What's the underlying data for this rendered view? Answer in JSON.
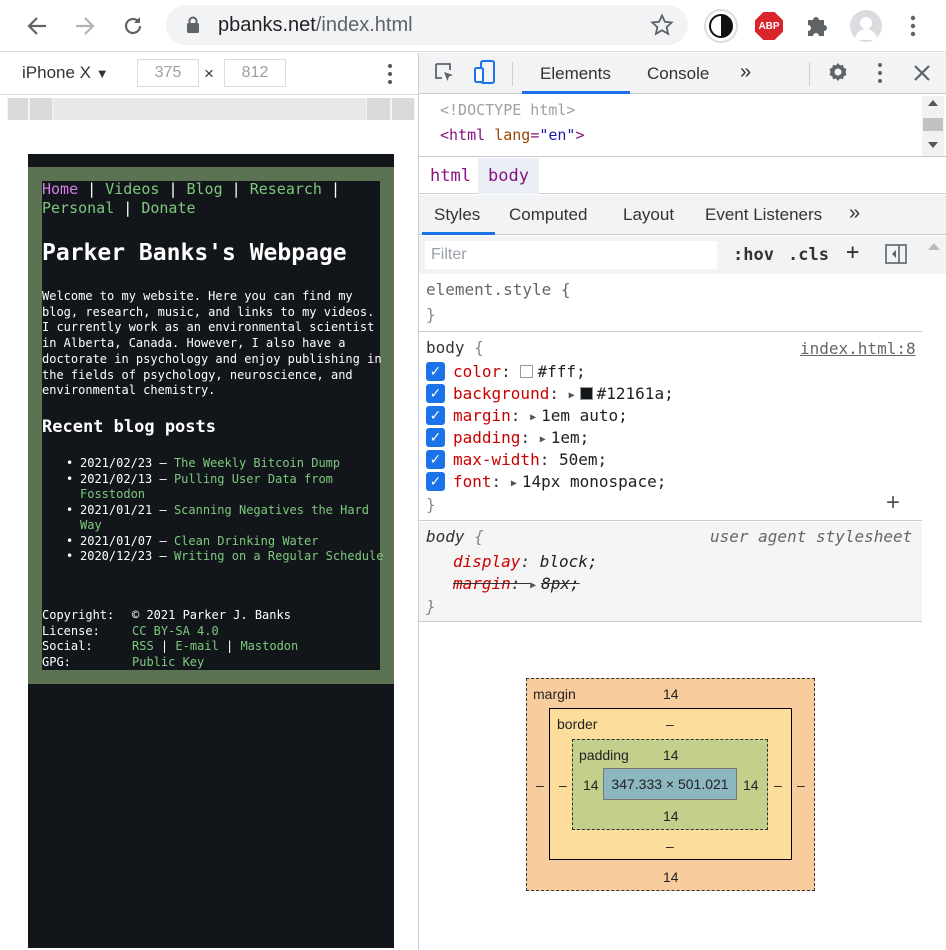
{
  "browser": {
    "url_host": "pbanks.net",
    "url_path": "/index.html",
    "abp_label": "ABP"
  },
  "device_toolbar": {
    "device": "iPhone X",
    "width": "375",
    "height": "812",
    "times": "×"
  },
  "page": {
    "nav": [
      "Home",
      "Videos",
      "Blog",
      "Research",
      "Personal",
      "Donate"
    ],
    "separator": "|",
    "title": "Parker Banks's Webpage",
    "intro": "Welcome to my website. Here you can find my blog, research, music, and links to my videos. I currently work as an environmental scientist in Alberta, Canada. However, I also have a doctorate in psychology and enjoy publishing in the fields of psychology, neuroscience, and environmental chemistry.",
    "recent_heading": "Recent blog posts",
    "posts": [
      {
        "date": "2021/02/23",
        "title": "The Weekly Bitcoin Dump"
      },
      {
        "date": "2021/02/13",
        "title": "Pulling User Data from Fosstodon"
      },
      {
        "date": "2021/01/21",
        "title": "Scanning Negatives the Hard Way"
      },
      {
        "date": "2021/01/07",
        "title": "Clean Drinking Water"
      },
      {
        "date": "2020/12/23",
        "title": "Writing on a Regular Schedule"
      }
    ],
    "dash": "–",
    "footer": {
      "copyright_label": "Copyright:",
      "copyright_value": "© 2021 Parker J. Banks",
      "license_label": "License:",
      "license_value": "CC BY-SA 4.0",
      "social_label": "Social:",
      "social_links": [
        "RSS",
        "E-mail",
        "Mastodon"
      ],
      "gpg_label": "GPG:",
      "gpg_value": "Public Key"
    }
  },
  "devtools": {
    "tabs": [
      "Elements",
      "Console"
    ],
    "more": "»",
    "dom": {
      "doctype": "<!DOCTYPE html>",
      "html_open": "<html",
      "attr_name": "lang",
      "attr_eq": "=",
      "attr_value": "\"en\"",
      "close": ">"
    },
    "breadcrumbs": [
      "html",
      "body"
    ],
    "subtabs": [
      "Styles",
      "Computed",
      "Layout",
      "Event Listeners"
    ],
    "filter_placeholder": "Filter",
    "hov": ":hov",
    "cls": ".cls",
    "plus": "+",
    "element_style": "element.style {",
    "close_brace": "}",
    "body_selector": "body",
    "open_brace": "{",
    "source": "index.html:8",
    "user_agent": "user agent stylesheet",
    "body_rules": [
      {
        "prop": "color",
        "value": "#fff;",
        "swatch": "#ffffff"
      },
      {
        "prop": "background",
        "value": "#12161a;",
        "swatch": "#12161a"
      },
      {
        "prop": "margin",
        "value": "1em auto;"
      },
      {
        "prop": "padding",
        "value": "1em;"
      },
      {
        "prop": "max-width",
        "value": "50em;"
      },
      {
        "prop": "font",
        "value": "14px monospace;"
      }
    ],
    "ua_rules": [
      {
        "prop": "display",
        "value": "block;"
      },
      {
        "prop": "margin",
        "value": "8px;"
      }
    ],
    "colon": ":",
    "box_model": {
      "margin_label": "margin",
      "border_label": "border",
      "padding_label": "padding",
      "margin_top": "14",
      "margin_bottom": "14",
      "margin_left": "–",
      "margin_right": "–",
      "border_top": "–",
      "border_bottom": "–",
      "border_left": "–",
      "border_right": "–",
      "padding_top": "14",
      "padding_bottom": "14",
      "padding_left": "14",
      "padding_right": "14",
      "content": "347.333 × 501.021"
    }
  }
}
